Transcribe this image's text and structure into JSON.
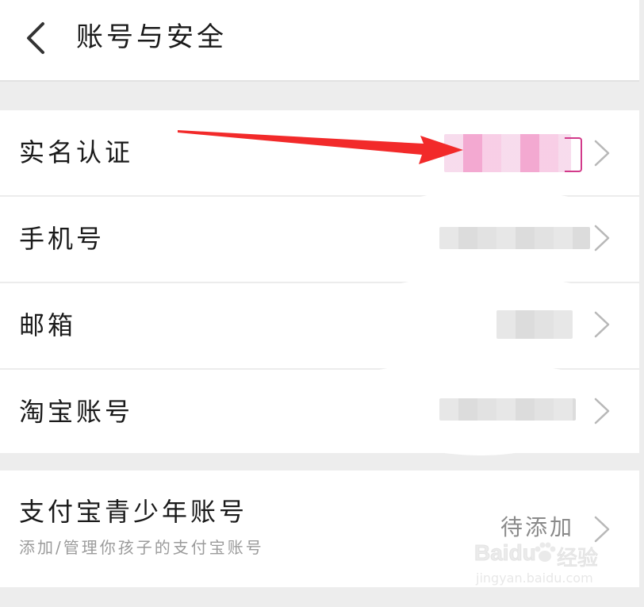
{
  "header": {
    "title": "账号与安全",
    "back_icon": "chevron-left-icon"
  },
  "rows": [
    {
      "label": "实名认证",
      "icon": "chevron-right-icon"
    },
    {
      "label": "手机号",
      "icon": "chevron-right-icon"
    },
    {
      "label": "邮箱",
      "icon": "chevron-right-icon"
    },
    {
      "label": "淘宝账号",
      "icon": "chevron-right-icon"
    }
  ],
  "teen_account": {
    "title": "支付宝青少年账号",
    "subtitle": "添加/管理你孩子的支付宝账号",
    "status": "待添加",
    "icon": "chevron-right-icon"
  },
  "annotation": {
    "arrow_color": "#f22a2a"
  },
  "watermark": {
    "brand": "Baidu",
    "brand_cn": "经验",
    "url": "jingyan.baidu.com"
  },
  "colors": {
    "background": "#ededed",
    "card": "#ffffff",
    "divider": "#ececec",
    "secondary_text": "#9b9b9b"
  }
}
